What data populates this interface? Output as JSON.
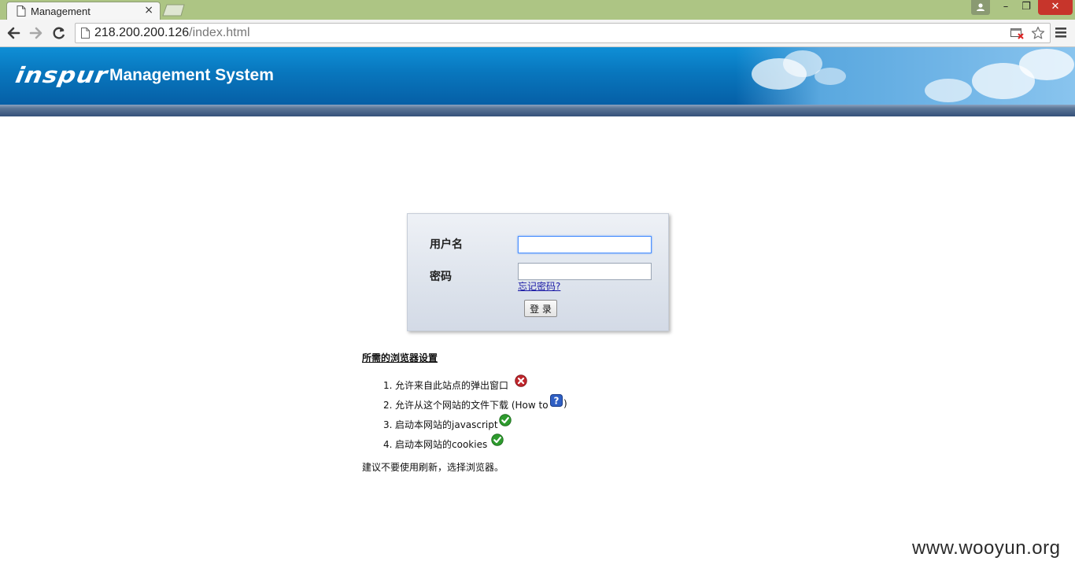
{
  "browser": {
    "tab_title": "Management",
    "tab_close": "×",
    "url_host": "218.200.200.126",
    "url_path": "/index.html",
    "window_controls": {
      "minimize": "–",
      "maximize": "❐",
      "close": "✕"
    }
  },
  "header": {
    "logo_text": "inspur",
    "title": "Management System"
  },
  "login": {
    "username_label": "用户名",
    "password_label": "密码",
    "username_value": "",
    "password_value": "",
    "forgot_link": "忘记密码?",
    "submit_label": "登 录"
  },
  "settings": {
    "title": "所需的浏览器设置",
    "items": [
      {
        "num": "1.",
        "text": "允许来自此站点的弹出窗口",
        "status": "error",
        "icon": "error-x-icon"
      },
      {
        "num": "2.",
        "text": "允许从这个网站的文件下载 (How to ",
        "suffix": ")",
        "status": "help",
        "icon": "help-question-icon"
      },
      {
        "num": "3.",
        "text": "启动本网站的javascript",
        "status": "ok",
        "icon": "check-icon"
      },
      {
        "num": "4.",
        "text": "启动本网站的cookies",
        "status": "ok",
        "icon": "check-icon"
      }
    ],
    "advice": "建议不要使用刷新，选择浏览器。"
  },
  "watermark": "www.wooyun.org",
  "colors": {
    "titlebar": "#adc584",
    "banner": "#0876bd",
    "error": "#c0272d",
    "ok": "#2e9b2e",
    "help": "#2f5fc4"
  }
}
